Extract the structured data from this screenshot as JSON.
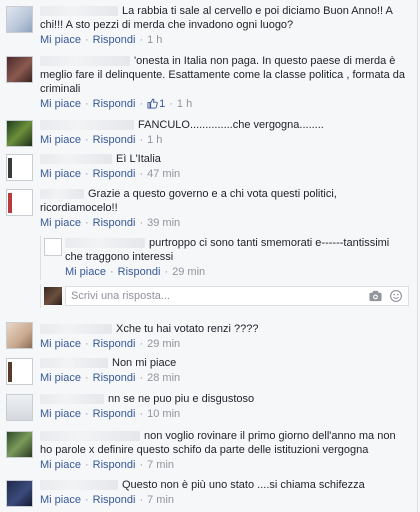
{
  "labels": {
    "like": "Mi piace",
    "reply": "Rispondi",
    "separator": "·"
  },
  "colors": {
    "link": "#365899",
    "meta": "#90949c",
    "text": "#1d2129",
    "background": "#f6f7f9"
  },
  "comments": [
    {
      "text": "La rabbia ti sale al cervello e poi diciamo Buon Anno!! A chi!!! A sto pezzi di merda che invadono ogni luogo?",
      "time": "1 h",
      "likes": null
    },
    {
      "text": "'onesta in Italia non paga. In questo paese di merda è meglio fare il delinquente. Esattamente come la classe politica , formata da criminali",
      "time": "1 h",
      "likes": "1"
    },
    {
      "text": "FANCULO..............che vergogna........",
      "time": "1 h",
      "likes": null
    },
    {
      "text": "Eì L'Italia",
      "time": "47 min",
      "likes": null
    },
    {
      "text": "Grazie a questo governo e a chi vota questi politici, ricordiamocelo!!",
      "time": "39 min",
      "likes": null
    },
    {
      "text": "purtroppo ci sono tanti smemorati e------tantissimi che traggono interessi",
      "time": "29 min",
      "likes": null,
      "is_reply": true
    },
    {
      "text": "Xche tu hai votato renzi ????",
      "time": "29 min",
      "likes": null
    },
    {
      "text": "Non mi piace",
      "time": "28 min",
      "likes": null
    },
    {
      "text": "nn se ne puo piu e disgustoso",
      "time": "10 min",
      "likes": null
    },
    {
      "text": "non voglio rovinare il primo giorno dell'anno ma non ho parole x definire questo schifo da parte delle istituzioni vergogna",
      "time": "7 min",
      "likes": null
    },
    {
      "text": "Questo non è più uno stato ....si chiama schifezza",
      "time": "7 min",
      "likes": null
    }
  ],
  "reply_input": {
    "placeholder": "Scrivi una risposta...",
    "camera_icon": "camera-icon",
    "emoji_icon": "emoji-icon"
  },
  "like_icon": "thumbs-up-icon"
}
